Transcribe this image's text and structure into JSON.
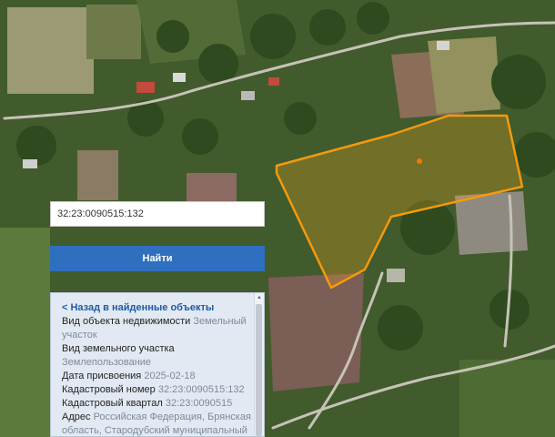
{
  "search": {
    "value": "32:23:0090515:132",
    "button_label": "Найти"
  },
  "info": {
    "back_label": "< Назад в найденные объекты",
    "fields": [
      {
        "label": "Вид объекта недвижимости",
        "value": "Земельный участок"
      },
      {
        "label": "Вид земельного участка",
        "value": "Землепользование"
      },
      {
        "label": "Дата присвоения",
        "value": "2025-02-18"
      },
      {
        "label": "Кадастровый номер",
        "value": "32:23:0090515:132"
      },
      {
        "label": "Кадастровый квартал",
        "value": "32:23:0090515"
      },
      {
        "label": "Адрес",
        "value": "Российская Федерация, Брянская область, Стародубский муниципальный"
      }
    ]
  },
  "map": {
    "parcel_outline_color": "#f59a0b",
    "parcel_fill_color": "#f5a623",
    "center_marker_color": "#f07a00"
  }
}
